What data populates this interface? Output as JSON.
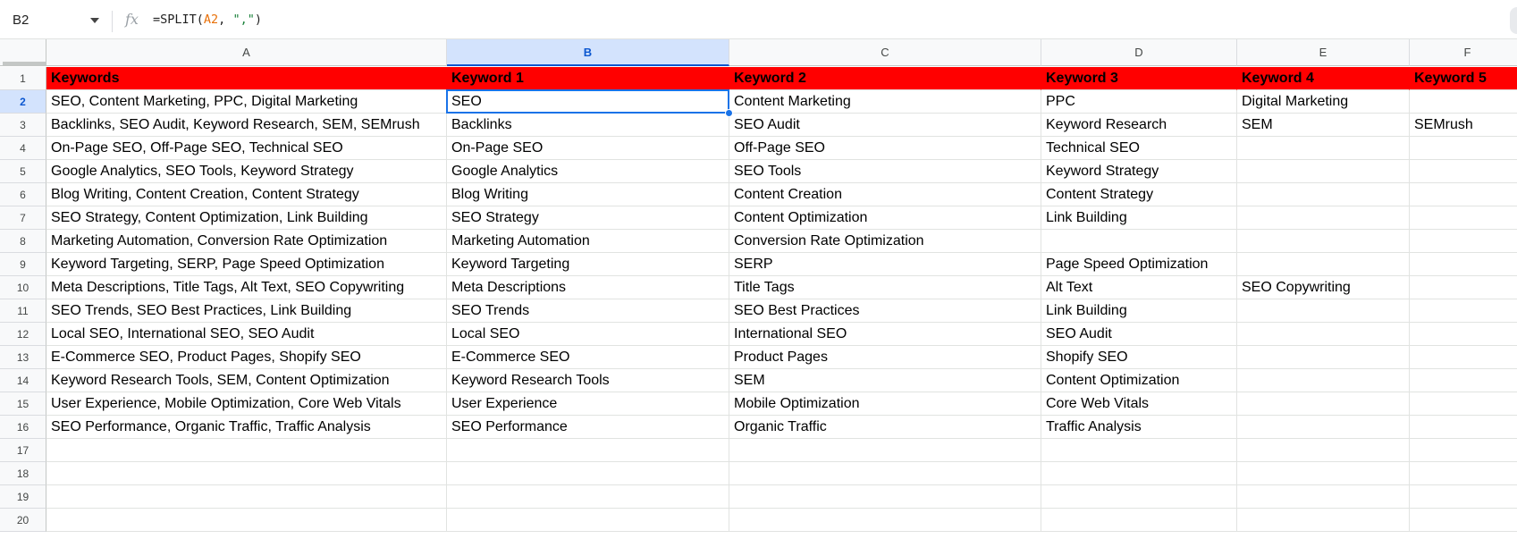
{
  "formula_bar": {
    "name_box": "B2",
    "fx_icon": "fx-icon",
    "formula_fn": "=SPLIT(",
    "formula_ref": "A2",
    "formula_sep": ", ",
    "formula_str": "\",\"",
    "formula_close": ")"
  },
  "colors": {
    "header_fill": "#ff0000",
    "selection": "#1a73e8"
  },
  "columns": [
    "A",
    "B",
    "C",
    "D",
    "E",
    "F"
  ],
  "selected_column": "B",
  "selected_row": "2",
  "row_numbers": [
    "1",
    "2",
    "3",
    "4",
    "5",
    "6",
    "7",
    "8",
    "9",
    "10",
    "11",
    "12",
    "13",
    "14",
    "15",
    "16",
    "17",
    "18",
    "19",
    "20"
  ],
  "header_row": [
    "Keywords",
    "Keyword 1",
    "Keyword 2",
    "Keyword 3",
    "Keyword 4",
    "Keyword 5"
  ],
  "rows": [
    [
      "SEO, Content Marketing, PPC, Digital Marketing",
      "SEO",
      "Content Marketing",
      "PPC",
      "Digital Marketing",
      ""
    ],
    [
      "Backlinks, SEO Audit, Keyword Research, SEM, SEMrush",
      "Backlinks",
      "SEO Audit",
      "Keyword Research",
      "SEM",
      "SEMrush"
    ],
    [
      "On-Page SEO, Off-Page SEO, Technical SEO",
      "On-Page SEO",
      "Off-Page SEO",
      "Technical SEO",
      "",
      ""
    ],
    [
      "Google Analytics, SEO Tools, Keyword Strategy",
      "Google Analytics",
      "SEO Tools",
      "Keyword Strategy",
      "",
      ""
    ],
    [
      "Blog Writing, Content Creation, Content Strategy",
      "Blog Writing",
      "Content Creation",
      "Content Strategy",
      "",
      ""
    ],
    [
      "SEO Strategy, Content Optimization, Link Building",
      "SEO Strategy",
      "Content Optimization",
      "Link Building",
      "",
      ""
    ],
    [
      "Marketing Automation, Conversion Rate Optimization",
      "Marketing Automation",
      "Conversion Rate Optimization",
      "",
      "",
      ""
    ],
    [
      "Keyword Targeting, SERP, Page Speed Optimization",
      "Keyword Targeting",
      "SERP",
      "Page Speed Optimization",
      "",
      ""
    ],
    [
      "Meta Descriptions, Title Tags, Alt Text, SEO Copywriting",
      "Meta Descriptions",
      "Title Tags",
      "Alt Text",
      "SEO Copywriting",
      ""
    ],
    [
      "SEO Trends, SEO Best Practices, Link Building",
      "SEO Trends",
      "SEO Best Practices",
      "Link Building",
      "",
      ""
    ],
    [
      "Local SEO, International SEO, SEO Audit",
      "Local SEO",
      "International SEO",
      "SEO Audit",
      "",
      ""
    ],
    [
      "E-Commerce SEO, Product Pages, Shopify SEO",
      "E-Commerce SEO",
      "Product Pages",
      "Shopify SEO",
      "",
      ""
    ],
    [
      "Keyword Research Tools, SEM, Content Optimization",
      "Keyword Research Tools",
      "SEM",
      "Content Optimization",
      "",
      ""
    ],
    [
      "User Experience, Mobile Optimization, Core Web Vitals",
      "User Experience",
      "Mobile Optimization",
      "Core Web Vitals",
      "",
      ""
    ],
    [
      "SEO Performance, Organic Traffic, Traffic Analysis",
      "SEO Performance",
      "Organic Traffic",
      "Traffic Analysis",
      "",
      ""
    ]
  ]
}
